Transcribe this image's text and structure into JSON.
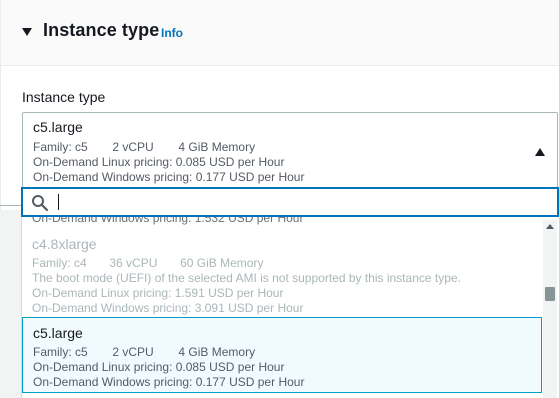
{
  "panel": {
    "title": "Instance type",
    "info": "Info"
  },
  "field": {
    "label": "Instance type"
  },
  "selected": {
    "name": "c5.large",
    "family": "Family: c5",
    "vcpu": "2 vCPU",
    "memory": "4 GiB Memory",
    "linux": "On-Demand Linux pricing: 0.085 USD per Hour",
    "windows": "On-Demand Windows pricing: 0.177 USD per Hour"
  },
  "search": {
    "placeholder": "",
    "value": ""
  },
  "dropdown": {
    "partial_line": "On-Demand Windows pricing: 1.532 USD per Hour",
    "options": [
      {
        "name": "c4.8xlarge",
        "family": "Family: c4",
        "vcpu": "36 vCPU",
        "memory": "60 GiB Memory",
        "warning": "The boot mode (UEFI) of the selected AMI is not supported by this instance type.",
        "linux": "On-Demand Linux pricing: 1.591 USD per Hour",
        "windows": "On-Demand Windows pricing: 3.091 USD per Hour",
        "disabled": true
      },
      {
        "name": "c5.large",
        "family": "Family: c5",
        "vcpu": "2 vCPU",
        "memory": "4 GiB Memory",
        "linux": "On-Demand Linux pricing: 0.085 USD per Hour",
        "windows": "On-Demand Windows pricing: 0.177 USD per Hour",
        "selected": true
      }
    ]
  },
  "icons": {
    "expand": "caret-down-icon",
    "collapse": "caret-up-icon",
    "search": "search-icon"
  },
  "colors": {
    "link": "#0073bb",
    "focus_border": "#0073bb",
    "selected_bg": "#f1faff",
    "selected_border": "#00a1c9",
    "disabled_text": "#aab7b8"
  }
}
